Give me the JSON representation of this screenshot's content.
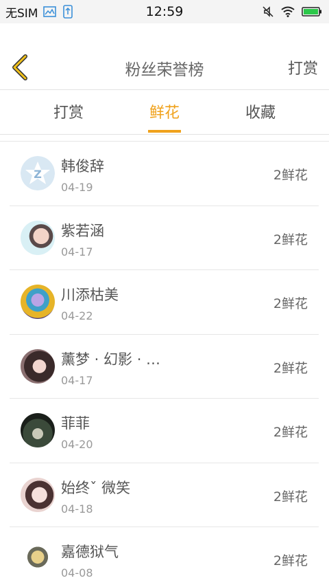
{
  "status_bar": {
    "carrier": "无SIM",
    "time": "12:59"
  },
  "header": {
    "title": "粉丝荣誉榜",
    "right_link": "打赏"
  },
  "tabs": [
    {
      "label": "打赏",
      "active": false
    },
    {
      "label": "鲜花",
      "active": true
    },
    {
      "label": "收藏",
      "active": false
    }
  ],
  "accent_color": "#f0a21c",
  "fans": [
    {
      "name": "韩俊辞",
      "date": "04-19",
      "count": "2鲜花"
    },
    {
      "name": "紫若涵",
      "date": "04-17",
      "count": "2鲜花"
    },
    {
      "name": "川添枯美",
      "date": "04-22",
      "count": "2鲜花"
    },
    {
      "name": "薰梦 · 幻影 · …",
      "date": "04-17",
      "count": "2鲜花"
    },
    {
      "name": "菲菲",
      "date": "04-20",
      "count": "2鲜花"
    },
    {
      "name": "始终ˇ 微笑",
      "date": "04-18",
      "count": "2鲜花"
    },
    {
      "name": "嘉德狱气",
      "date": "04-08",
      "count": "2鲜花"
    }
  ]
}
